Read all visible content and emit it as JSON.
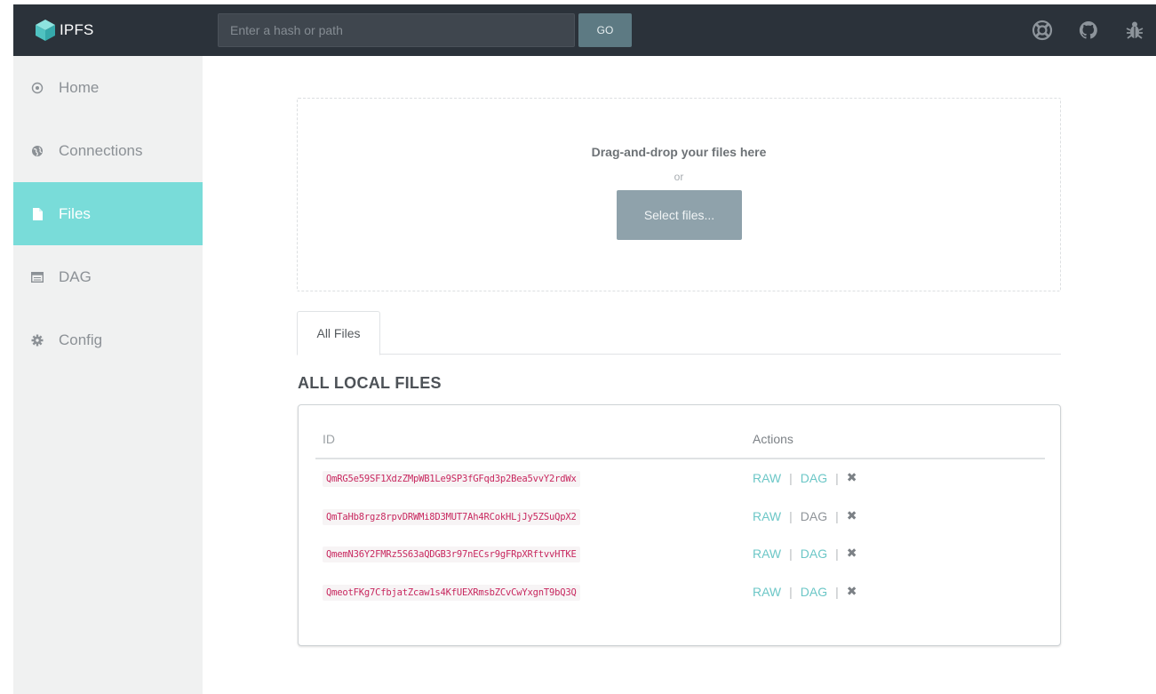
{
  "app": {
    "brand": "IPFS"
  },
  "topbar": {
    "search_placeholder": "Enter a hash or path",
    "go_label": "GO",
    "icons": [
      "lifebuoy-icon",
      "github-icon",
      "bug-icon"
    ]
  },
  "sidebar": {
    "items": [
      {
        "label": "Home",
        "icon": "home-circle-icon",
        "active": false
      },
      {
        "label": "Connections",
        "icon": "globe-icon",
        "active": false
      },
      {
        "label": "Files",
        "icon": "file-icon",
        "active": true
      },
      {
        "label": "DAG",
        "icon": "window-icon",
        "active": false
      },
      {
        "label": "Config",
        "icon": "gear-icon",
        "active": false
      }
    ]
  },
  "dropzone": {
    "title": "Drag-and-drop your files here",
    "or": "or",
    "select_label": "Select files..."
  },
  "tabs": [
    {
      "label": "All Files"
    }
  ],
  "files": {
    "title": "ALL LOCAL FILES",
    "columns": {
      "id": "ID",
      "actions": "Actions"
    },
    "rows": [
      {
        "hash": "QmRG5e59SF1XdzZMpWB1Le9SP3fGFqd3p2Bea5vvY2rdWx",
        "raw": "RAW",
        "dag": "DAG"
      },
      {
        "hash": "QmTaHb8rgz8rpvDRWMi8D3MUT7Ah4RCokHLjJy5ZSuQpX2",
        "raw": "RAW",
        "dag": "DAG"
      },
      {
        "hash": "QmemN36Y2FMRz5S63aQDGB3r97nECsr9gFRpXRftvvHTKE",
        "raw": "RAW",
        "dag": "DAG"
      },
      {
        "hash": "QmeotFKg7CfbjatZcaw1s4KfUEXRmsbZCvCwYxgnT9bQ3Q",
        "raw": "RAW",
        "dag": "DAG"
      }
    ],
    "separator": "|",
    "delete_glyph": "✖"
  },
  "colors": {
    "topbar": "#2b323a",
    "sidebar": "#f0f1f1",
    "active": "#79dcd9",
    "link": "#6cc7c7",
    "hash": "#c8285f"
  }
}
